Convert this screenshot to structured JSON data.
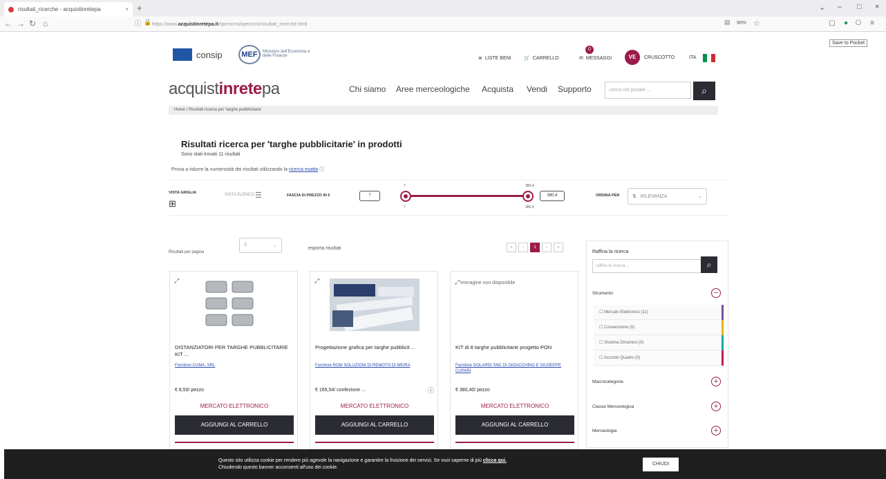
{
  "browser": {
    "tab_title": "risultati_ricerche - acquistinretepa",
    "url_prefix": "https://www.",
    "url_domain": "acquistinretepa.it",
    "url_rest": "/opencms/opencms/risultati_ricerche.html",
    "zoom": "90%",
    "tooltip": "Save to Pocket"
  },
  "header": {
    "consip": "consip",
    "mef": "MEF",
    "mef_sub": "Ministero dell'Economia e delle Finanze",
    "top_links": [
      "LISTE BENI",
      "CARRELLO",
      "MESSAGGI",
      "CRUSCOTTO",
      "ITA"
    ],
    "messages_count": "0",
    "user_initials": "VE",
    "logo_pre": "acquist",
    "logo_mid": "inrete",
    "logo_post": "pa",
    "menu": [
      "Chi siamo",
      "Aree merceologiche",
      "Acquista",
      "Vendi",
      "Supporto"
    ],
    "search_placeholder": "cerca nel portale ..."
  },
  "breadcrumb": "Home / Risultati ricerca per 'targhe pubblicitarie'",
  "results": {
    "title": "Risultati ricerca per 'targhe pubblicitarie' in prodotti",
    "count": "Sono stati trovati 11 risultati",
    "hint": "Prova a ridurre la numerosità dei risultati utilizzando la",
    "hint_link": "ricerca esatta"
  },
  "filters": {
    "view_grid": "VISTA GRIGLIA",
    "view_list": "VISTA ELENCO",
    "price_range": "FASCIA DI PREZZO IN €",
    "price_min": "7",
    "price_max": "380,4",
    "slider_min": "7",
    "slider_max": "380,4",
    "sort_label": "ORDINA PER",
    "sort_value": "RILEVANZA"
  },
  "list_controls": {
    "per_page_label": "Risultati per pagina",
    "per_page_value": "9",
    "export": "esporta risultati",
    "current_page": "1"
  },
  "products": [
    {
      "name": "DISTANZIATORI PER TARGHE PUBBLICITARIE KIT ...",
      "supplier": "Fornitore CUMA, SRL",
      "price": "€ 8,50/ pezzo",
      "market": "MERCATO ELETTRONICO",
      "button": "AGGIUNGI AL CARRELLO"
    },
    {
      "name": "Progettazione grafica per targhe pubblicit ...",
      "supplier": "Fornitore ROM SOLUZIONI DI REMOTO DI MEIRA",
      "price": "€ 165,54/ confezione ...",
      "market": "MERCATO ELETTRONICO",
      "button": "AGGIUNGI AL CARRELLO"
    },
    {
      "name": "KIT di 8 targhe pubblicitarie progetto PON",
      "supplier": "Fornitore GOLARDI SNC DI GIOACCHINO E GIUSEPPE CUPARI",
      "price": "€ 380,40/ pezzo",
      "market": "MERCATO ELETTRONICO",
      "button": "AGGIUNGI AL CARRELLO",
      "image_text": "Immagine non disponibile"
    }
  ],
  "sidebar": {
    "title": "Raffina la ricerca",
    "placeholder": "raffina la ricerca ...",
    "facets": [
      "Strumento",
      "Macrocategoria",
      "Classe Merceologica",
      "Merceologia"
    ],
    "strumento_items": [
      "Mercato Elettronico (11)",
      "Convenzione (0)",
      "Sistema Dinamico (0)",
      "Accordo Quadro (0)"
    ],
    "strumento_colors": [
      "#7a4fa0",
      "#e8b400",
      "#1ba6a6",
      "#c2185b"
    ]
  },
  "cookie": {
    "line1": "Questo sito utilizza cookie per rendere più agevole la navigazione e garantire la fruizione dei servizi. Se vuoi saperne di più",
    "link": "clicca qui.",
    "line2": "Chiudendo questo banner acconsenti all'uso dei cookie.",
    "close": "CHIUDI"
  },
  "colors": {
    "accent": "#9b1c4a",
    "dark": "#2b2b33"
  }
}
